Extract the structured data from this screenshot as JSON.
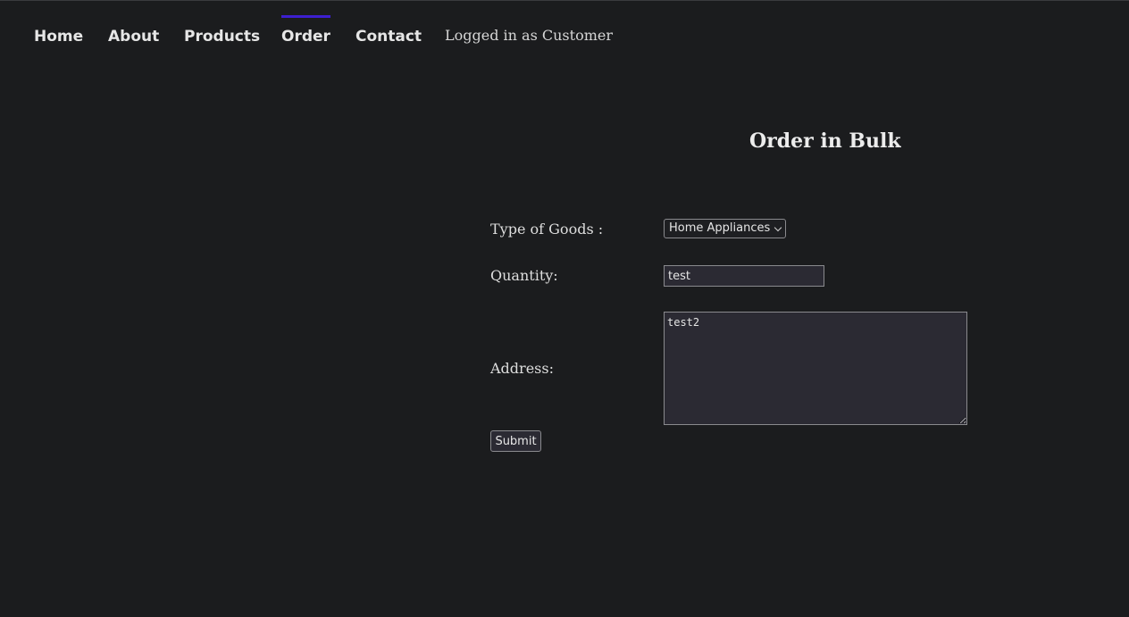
{
  "nav": {
    "items": [
      {
        "label": "Home",
        "active": false
      },
      {
        "label": "About",
        "active": false
      },
      {
        "label": "Products",
        "active": false
      },
      {
        "label": "Order",
        "active": true
      },
      {
        "label": "Contact",
        "active": false
      }
    ],
    "user_status": "Logged in as Customer",
    "active_indicator_color": "#3d1fd0"
  },
  "page": {
    "title": "Order in Bulk"
  },
  "form": {
    "goods_label": "Type of Goods :",
    "goods_value": "Home Appliances",
    "quantity_label": "Quantity:",
    "quantity_value": "test",
    "address_label": "Address:",
    "address_value": "test2",
    "submit_label": "Submit"
  },
  "icons": {
    "select_arrow": "chevron-down-icon",
    "resize_handle": "resize-grip-icon"
  }
}
